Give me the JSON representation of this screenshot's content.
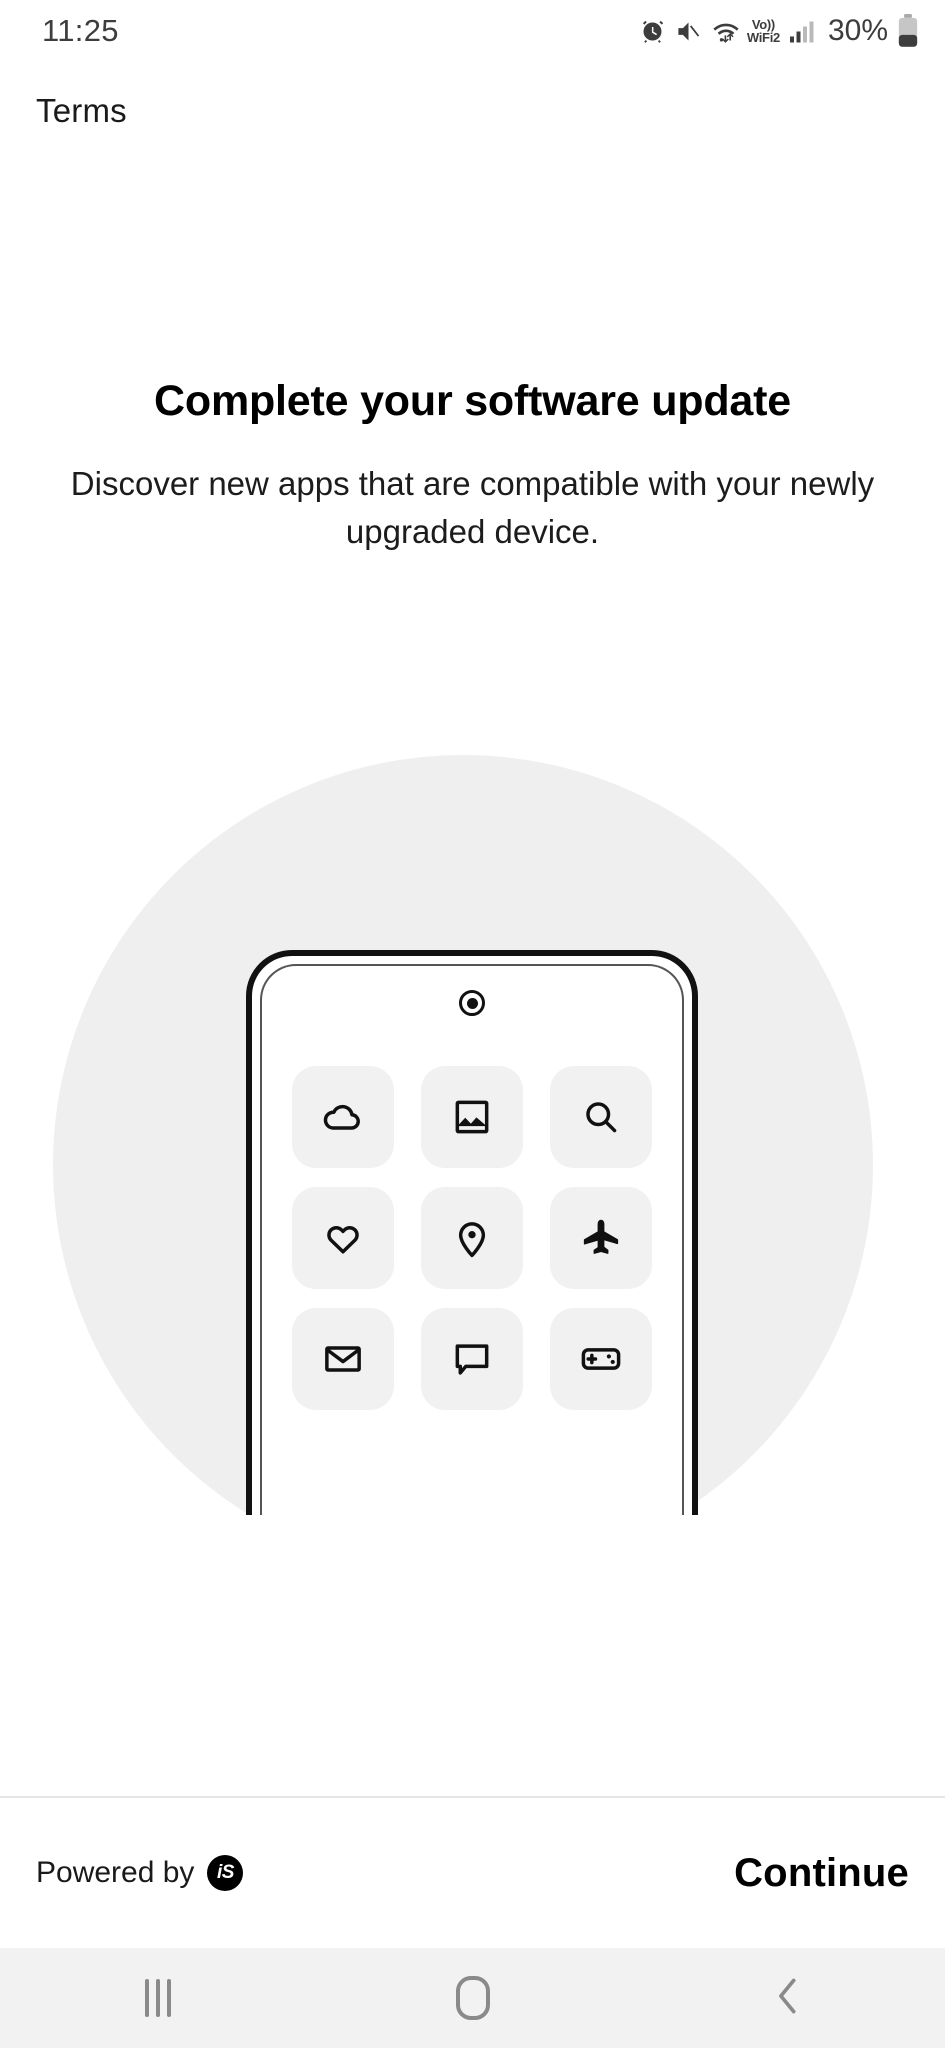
{
  "statusbar": {
    "time": "11:25",
    "battery_percent": "30%",
    "network_label_top": "Vo))",
    "network_label_bottom": "WiFi2",
    "icons": [
      "alarm-icon",
      "mute-icon",
      "wifi-icon",
      "volte-wifi-label",
      "signal-bars-icon",
      "battery-icon"
    ]
  },
  "header": {
    "terms_label": "Terms"
  },
  "main": {
    "headline": "Complete your software update",
    "subhead": "Discover new apps that are compatible with your newly upgraded device.",
    "illustration": {
      "app_icons": [
        "cloud-icon",
        "image-icon",
        "search-icon",
        "heart-icon",
        "location-pin-icon",
        "airplane-icon",
        "mail-icon",
        "chat-bubble-icon",
        "game-controller-icon"
      ],
      "circle_color": "#efefef",
      "tile_color": "#f1f1f1"
    }
  },
  "footer": {
    "powered_by_label": "Powered by",
    "brand_badge": "iS",
    "continue_label": "Continue"
  },
  "navbar": {
    "recents_label": "recents-button",
    "home_label": "home-button",
    "back_label": "back-button"
  }
}
